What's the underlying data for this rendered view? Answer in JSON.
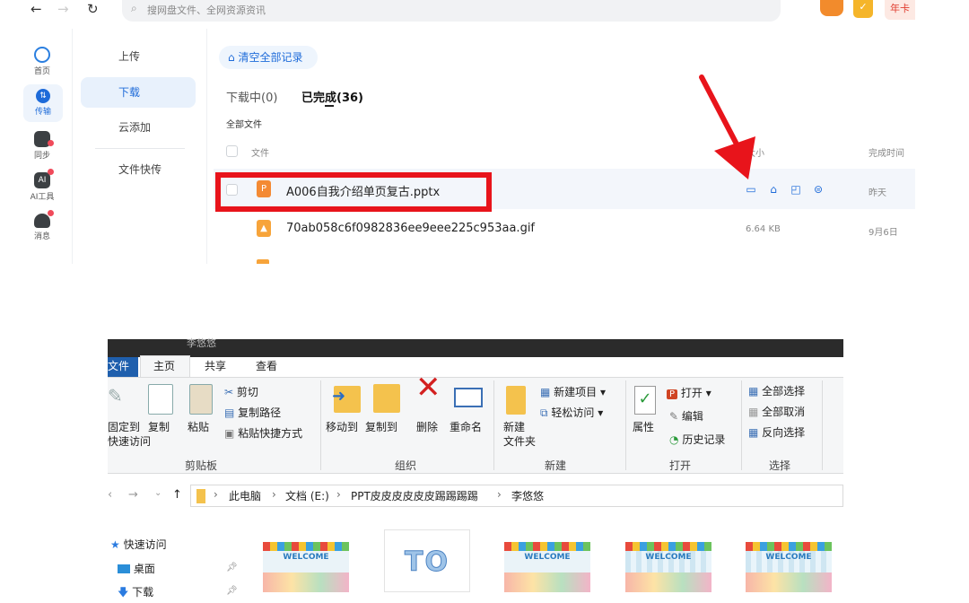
{
  "top_app": {
    "search_placeholder": "搜网盘文件、全网资源资讯",
    "year_card": "年卡",
    "rail": [
      {
        "label": "首页"
      },
      {
        "label": "传输"
      },
      {
        "label": "同步"
      },
      {
        "label": "AI工具"
      },
      {
        "label": "消息"
      }
    ],
    "subnav": [
      {
        "label": "上传"
      },
      {
        "label": "下载"
      },
      {
        "label": "云添加"
      },
      {
        "label": "文件快传"
      }
    ],
    "clear_all": "清空全部记录",
    "tabs": {
      "downloading": "下载中(0)",
      "done": "已完成(36)"
    },
    "all_files": "全部文件",
    "columns": {
      "file": "文件",
      "size": "大小",
      "finished": "完成时间"
    },
    "rows": [
      {
        "name": "A006自我介绍单页复古.pptx",
        "size": "",
        "finished": "昨天",
        "icon": "P"
      },
      {
        "name": "70ab058c6f0982836ee9eee225c953aa.gif",
        "size": "6.64 KB",
        "finished": "9月6日",
        "icon": "▲"
      }
    ],
    "colors": {
      "accent": "#1e6bd9",
      "highlight": "#e8141b"
    }
  },
  "explorer": {
    "title": "李悠悠",
    "tabs": {
      "file": "文件",
      "home": "主页",
      "share": "共享",
      "view": "查看"
    },
    "clipboard": {
      "pin_line1": "固定到",
      "pin_line2": "快速访问",
      "copy": "复制",
      "paste": "粘贴",
      "cut": "剪切",
      "copy_path": "复制路径",
      "paste_shortcut": "粘贴快捷方式",
      "group": "剪贴板"
    },
    "organize": {
      "move_to": "移动到",
      "copy_to": "复制到",
      "delete": "删除",
      "rename": "重命名",
      "group": "组织"
    },
    "new": {
      "new_folder_1": "新建",
      "new_folder_2": "文件夹",
      "new_item": "新建项目",
      "easy_access": "轻松访问",
      "group": "新建"
    },
    "open": {
      "properties": "属性",
      "open": "打开",
      "edit": "编辑",
      "history": "历史记录",
      "group": "打开"
    },
    "select": {
      "select_all": "全部选择",
      "select_none": "全部取消",
      "invert": "反向选择",
      "group": "选择"
    },
    "breadcrumb": [
      "此电脑",
      "文档 (E:)",
      "PPT皮皮皮皮皮皮踢踢踢踢",
      "李悠悠"
    ],
    "nav": [
      {
        "label": "快速访问"
      },
      {
        "label": "桌面"
      },
      {
        "label": "下载"
      }
    ],
    "thumbs": [
      {
        "type": "welcome",
        "text": "WELCOME"
      },
      {
        "type": "to",
        "text": "TO"
      },
      {
        "type": "welcome",
        "text": "WELCOME"
      },
      {
        "type": "welcome-stripe",
        "text": "WELCOME"
      },
      {
        "type": "welcome-stripe",
        "text": "WELCOME"
      }
    ]
  }
}
